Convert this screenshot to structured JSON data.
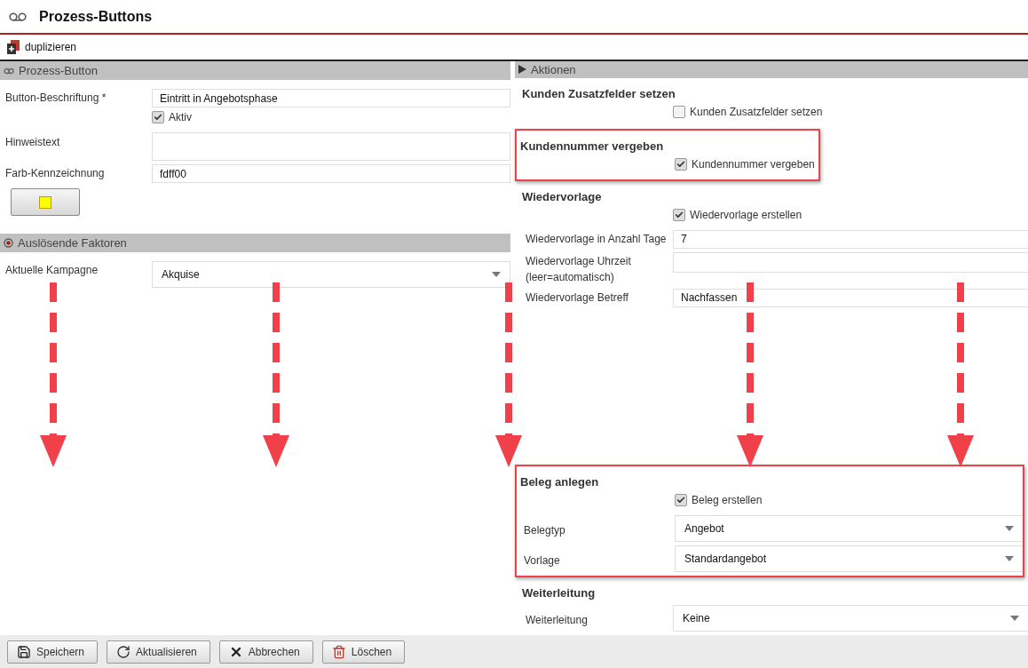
{
  "header": {
    "title": "Prozess-Buttons"
  },
  "toolbar": [
    {
      "label": "duplizieren"
    }
  ],
  "left": [
    {
      "title": "Prozess-Button",
      "kind": "link",
      "rows": [
        {
          "kind": "input",
          "label": "Button-Beschriftung *",
          "value": "Eintritt in Angebotsphase"
        },
        {
          "kind": "checkbox",
          "label": "Aktiv",
          "checked": true
        },
        {
          "kind": "textarea",
          "label": "Hinweistext"
        },
        {
          "kind": "input",
          "label": "Farb-Kennzeichnung",
          "value": "fdff00"
        },
        {
          "kind": "swatch"
        }
      ]
    },
    {
      "title": "Auslösende Faktoren",
      "kind": "radio",
      "rows": [
        {
          "kind": "select",
          "label": "Aktuelle Kampagne",
          "value": "Akquise"
        }
      ]
    }
  ],
  "right": {
    "title": "Aktionen",
    "groups": [
      {
        "heading": "Kunden Zusatzfelder setzen",
        "highlighted": false,
        "rows": [
          {
            "kind": "checkbox",
            "label": "Kunden Zusatzfelder setzen",
            "checked": false
          }
        ]
      },
      {
        "heading": "Kundennummer vergeben",
        "highlighted": true,
        "rows": [
          {
            "kind": "checkbox",
            "label": "Kundennummer vergeben",
            "checked": true
          }
        ]
      },
      {
        "heading": "Wiedervorlage",
        "highlighted": false,
        "rows": [
          {
            "kind": "checkbox",
            "label": "Wiedervorlage erstellen",
            "checked": true
          },
          {
            "kind": "input",
            "label": "Wiedervorlage in Anzahl Tage",
            "value": "7"
          },
          {
            "kind": "input",
            "label": "Wiedervorlage Uhrzeit (leer=automatisch)"
          },
          {
            "kind": "input",
            "label": "Wiedervorlage Betreff",
            "value": "Nachfassen"
          }
        ]
      },
      {
        "heading": "Beleg anlegen",
        "highlighted": true,
        "rows": [
          {
            "kind": "checkbox",
            "label": "Beleg erstellen",
            "checked": true
          },
          {
            "kind": "select",
            "label": "Belegtyp",
            "value": "Angebot"
          },
          {
            "kind": "select",
            "label": "Vorlage",
            "value": "Standardangebot"
          }
        ]
      },
      {
        "heading": "Weiterleitung",
        "highlighted": false,
        "rows": [
          {
            "kind": "select",
            "label": "Weiterleitung",
            "value": "Keine"
          }
        ]
      }
    ]
  },
  "footer": [
    {
      "label": "Speichern",
      "kind": "save"
    },
    {
      "label": "Aktualisieren",
      "kind": "refresh"
    },
    {
      "label": "Abbrechen",
      "kind": "cancel"
    },
    {
      "label": "Löschen",
      "kind": "delete"
    }
  ]
}
